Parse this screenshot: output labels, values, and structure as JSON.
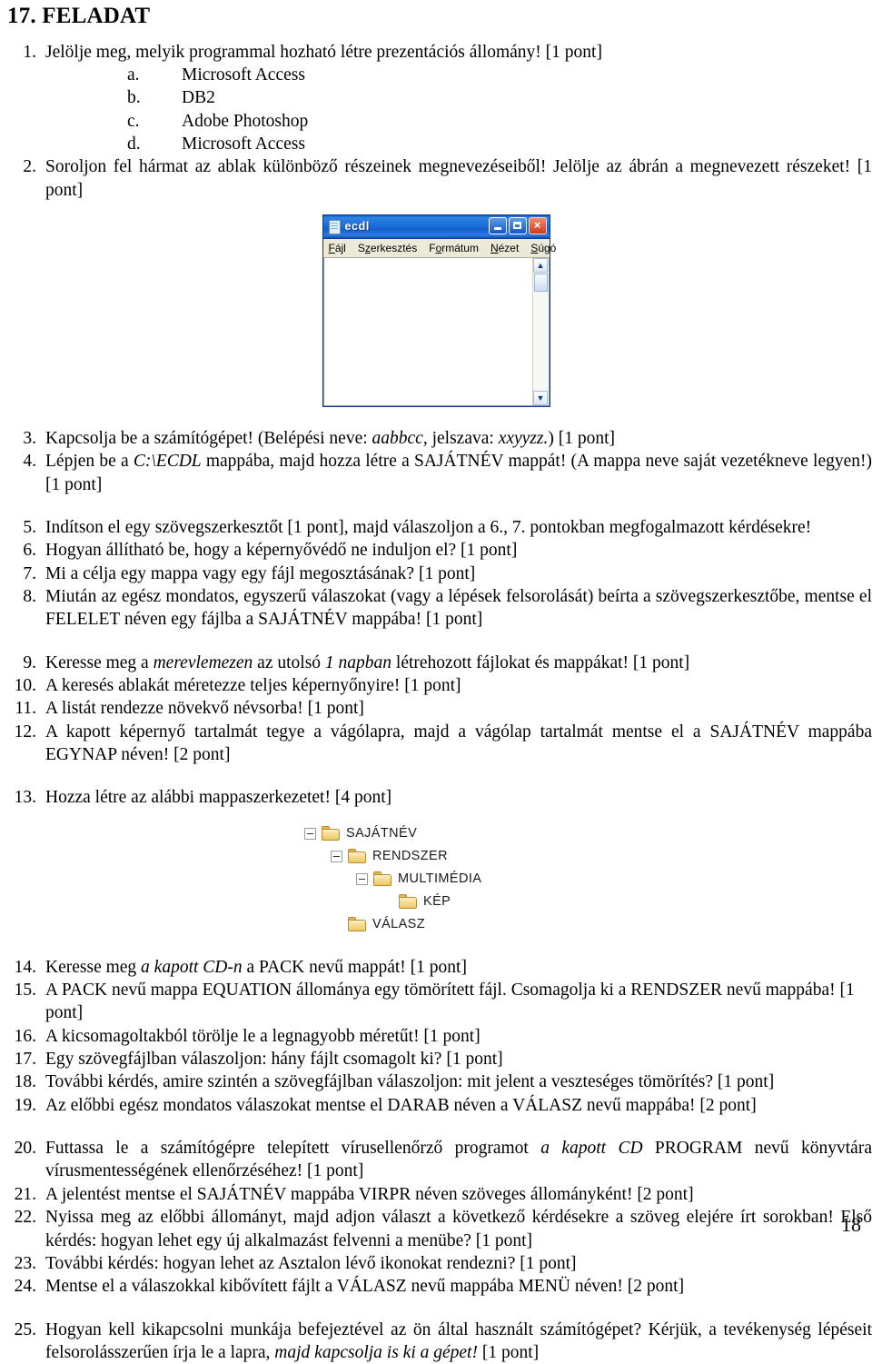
{
  "document": {
    "title": "17. FELADAT",
    "page_number": "18"
  },
  "questions": [
    {
      "num": "1.",
      "text": "Jelölje meg, melyik programmal hozható létre prezentációs állomány! [1 pont]"
    },
    {
      "num": "2.",
      "text": "Soroljon fel hármat az ablak különböző részeinek megnevezéseiből! Jelölje az ábrán a megnevezett részeket! [1 pont]"
    },
    {
      "num": "3.",
      "prefix": "Kapcsolja be a számítógépet! (Belépési neve: ",
      "italic1": "aabbcc",
      "mid": ", jelszava: ",
      "italic2": "xxyyzz.",
      "suffix": ") [1 pont]"
    },
    {
      "num": "4.",
      "prefix": "Lépjen be a ",
      "italic1": "C:\\ECDL",
      "suffix": " mappába, majd hozza létre a SAJÁTNÉV mappát! (A mappa neve saját vezetékneve legyen!) [1 pont]"
    },
    {
      "num": "5.",
      "text": "Indítson el egy szövegszerkesztőt [1 pont], majd válaszoljon a 6., 7. pontokban megfogalmazott kérdésekre!"
    },
    {
      "num": "6.",
      "text": "Hogyan állítható be, hogy a képernyővédő ne induljon el? [1 pont]"
    },
    {
      "num": "7.",
      "text": "Mi a célja egy mappa vagy egy fájl megosztásának? [1 pont]"
    },
    {
      "num": "8.",
      "text": "Miután az egész mondatos, egyszerű válaszokat (vagy a lépések felsorolását) beírta a szövegszerkesztőbe, mentse el FELELET néven egy fájlba a SAJÁTNÉV mappába! [1 pont]"
    },
    {
      "num": "9.",
      "prefix": "Keresse meg a ",
      "italic1": "merevlemezen",
      "mid": " az utolsó ",
      "italic2": "1 napban",
      "suffix": " létrehozott fájlokat és mappákat! [1 pont]"
    },
    {
      "num": "10.",
      "text": "A keresés ablakát méretezze teljes képernyőnyire! [1 pont]"
    },
    {
      "num": "11.",
      "text": "A listát rendezze növekvő névsorba! [1 pont]"
    },
    {
      "num": "12.",
      "text": "A kapott képernyő tartalmát tegye a vágólapra, majd a vágólap tartalmát mentse el a SAJÁTNÉV mappába EGYNAP néven! [2 pont]"
    },
    {
      "num": "13.",
      "text": "Hozza létre az alábbi mappaszerkezetet! [4 pont]"
    },
    {
      "num": "14.",
      "prefix": "Keresse meg ",
      "italic1": "a kapott CD-n",
      "suffix": " a PACK nevű mappát! [1 pont]"
    },
    {
      "num": "15.",
      "text": "A PACK nevű mappa EQUATION állománya egy tömörített fájl. Csomagolja ki a RENDSZER nevű mappába! [1 pont]"
    },
    {
      "num": "16.",
      "text": "A kicsomagoltakból törölje le a legnagyobb méretűt! [1 pont]"
    },
    {
      "num": "17.",
      "text": "Egy szövegfájlban válaszoljon: hány fájlt csomagolt ki? [1 pont]"
    },
    {
      "num": "18.",
      "text": "További kérdés, amire szintén a szövegfájlban válaszoljon: mit jelent a veszteséges tömörítés? [1 pont]"
    },
    {
      "num": "19.",
      "text": "Az előbbi egész mondatos válaszokat mentse el DARAB néven a VÁLASZ nevű mappába! [2 pont]"
    },
    {
      "num": "20.",
      "prefix": "Futtassa le a számítógépre telepített vírusellenőrző programot ",
      "italic1": "a kapott CD",
      "suffix": " PROGRAM nevű könyvtára vírusmentességének ellenőrzéséhez! [1 pont]"
    },
    {
      "num": "21.",
      "text": "A jelentést mentse el SAJÁTNÉV mappába VIRPR néven szöveges állományként! [2 pont]"
    },
    {
      "num": "22.",
      "text": "Nyissa meg az előbbi állományt, majd adjon választ a következő kérdésekre a szöveg elejére írt sorokban! Első kérdés: hogyan lehet egy új alkalmazást felvenni a menübe? [1 pont]"
    },
    {
      "num": "23.",
      "text": "További kérdés: hogyan lehet az Asztalon lévő ikonokat rendezni? [1 pont]"
    },
    {
      "num": "24.",
      "text": "Mentse el a válaszokkal kibővített fájlt a VÁLASZ nevű mappába MENÜ néven! [2 pont]"
    },
    {
      "num": "25.",
      "prefix": "Hogyan kell kikapcsolni munkája befejeztével az ön által használt számítógépet? Kérjük, a tevékenység lépéseit felsorolásszerűen írja le a lapra, ",
      "italic1": "majd kapcsolja is ki a gépet!",
      "suffix": " [1 pont]"
    }
  ],
  "options": [
    {
      "letter": "a.",
      "label": "Microsoft Access"
    },
    {
      "letter": "b.",
      "label": "DB2"
    },
    {
      "letter": "c.",
      "label": "Adobe Photoshop"
    },
    {
      "letter": "d.",
      "label": "Microsoft Access"
    }
  ],
  "window_figure": {
    "title": "ecdl",
    "menus": [
      {
        "underlined": "F",
        "rest": "ájl"
      },
      {
        "underlined": "S",
        "rest": "zerkesztés"
      },
      {
        "underlined": "F",
        "rest": "ormátum",
        "pre": ""
      },
      {
        "underlined": "N",
        "rest": "ézet"
      },
      {
        "underlined": "S",
        "rest": "úgó"
      }
    ],
    "menu_labels": [
      "Fájl",
      "Szerkesztés",
      "Formátum",
      "Nézet",
      "Súgó"
    ],
    "buttons": {
      "minimize": "minimize",
      "maximize": "maximize",
      "close": "×"
    },
    "titlebar_color": "#1560cd",
    "close_color": "#cf3b1c"
  },
  "folder_tree": [
    {
      "label": "SAJÁTNÉV",
      "depth": 0,
      "expander": true
    },
    {
      "label": "RENDSZER",
      "depth": 1,
      "expander": true
    },
    {
      "label": "MULTIMÉDIA",
      "depth": 2,
      "expander": true
    },
    {
      "label": "KÉP",
      "depth": 3,
      "expander": false
    },
    {
      "label": "VÁLASZ",
      "depth": 1,
      "expander": false
    }
  ]
}
